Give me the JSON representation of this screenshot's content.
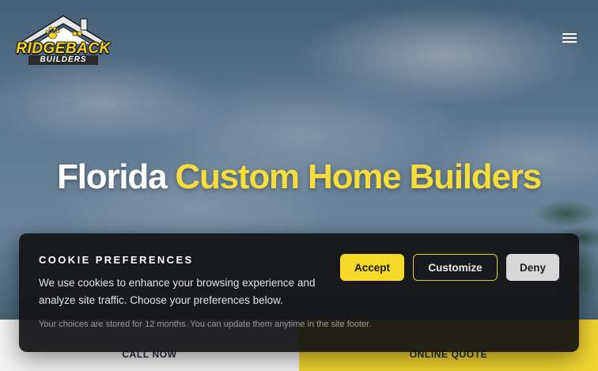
{
  "header": {
    "logo_text": "RIDGEBACK",
    "logo_subtext": "BUILDERS",
    "menu_icon": "hamburger-menu-icon"
  },
  "hero": {
    "title_white": "Florida",
    "title_yellow": "Custom Home Builders"
  },
  "cta": {
    "call_label": "CALL NOW",
    "quote_label": "ONLINE QUOTE"
  },
  "cookie": {
    "title": "COOKIE PREFERENCES",
    "body": "We use cookies to enhance your browsing experience and analyze site traffic. Choose your preferences below.",
    "note": "Your choices are stored for 12 months. You can update them anytime in the site footer.",
    "accept_label": "Accept",
    "customize_label": "Customize",
    "deny_label": "Deny"
  },
  "colors": {
    "accent_yellow": "#f6dd3c",
    "dark_panel": "#121214",
    "deny_gray": "#d8d8d8"
  }
}
